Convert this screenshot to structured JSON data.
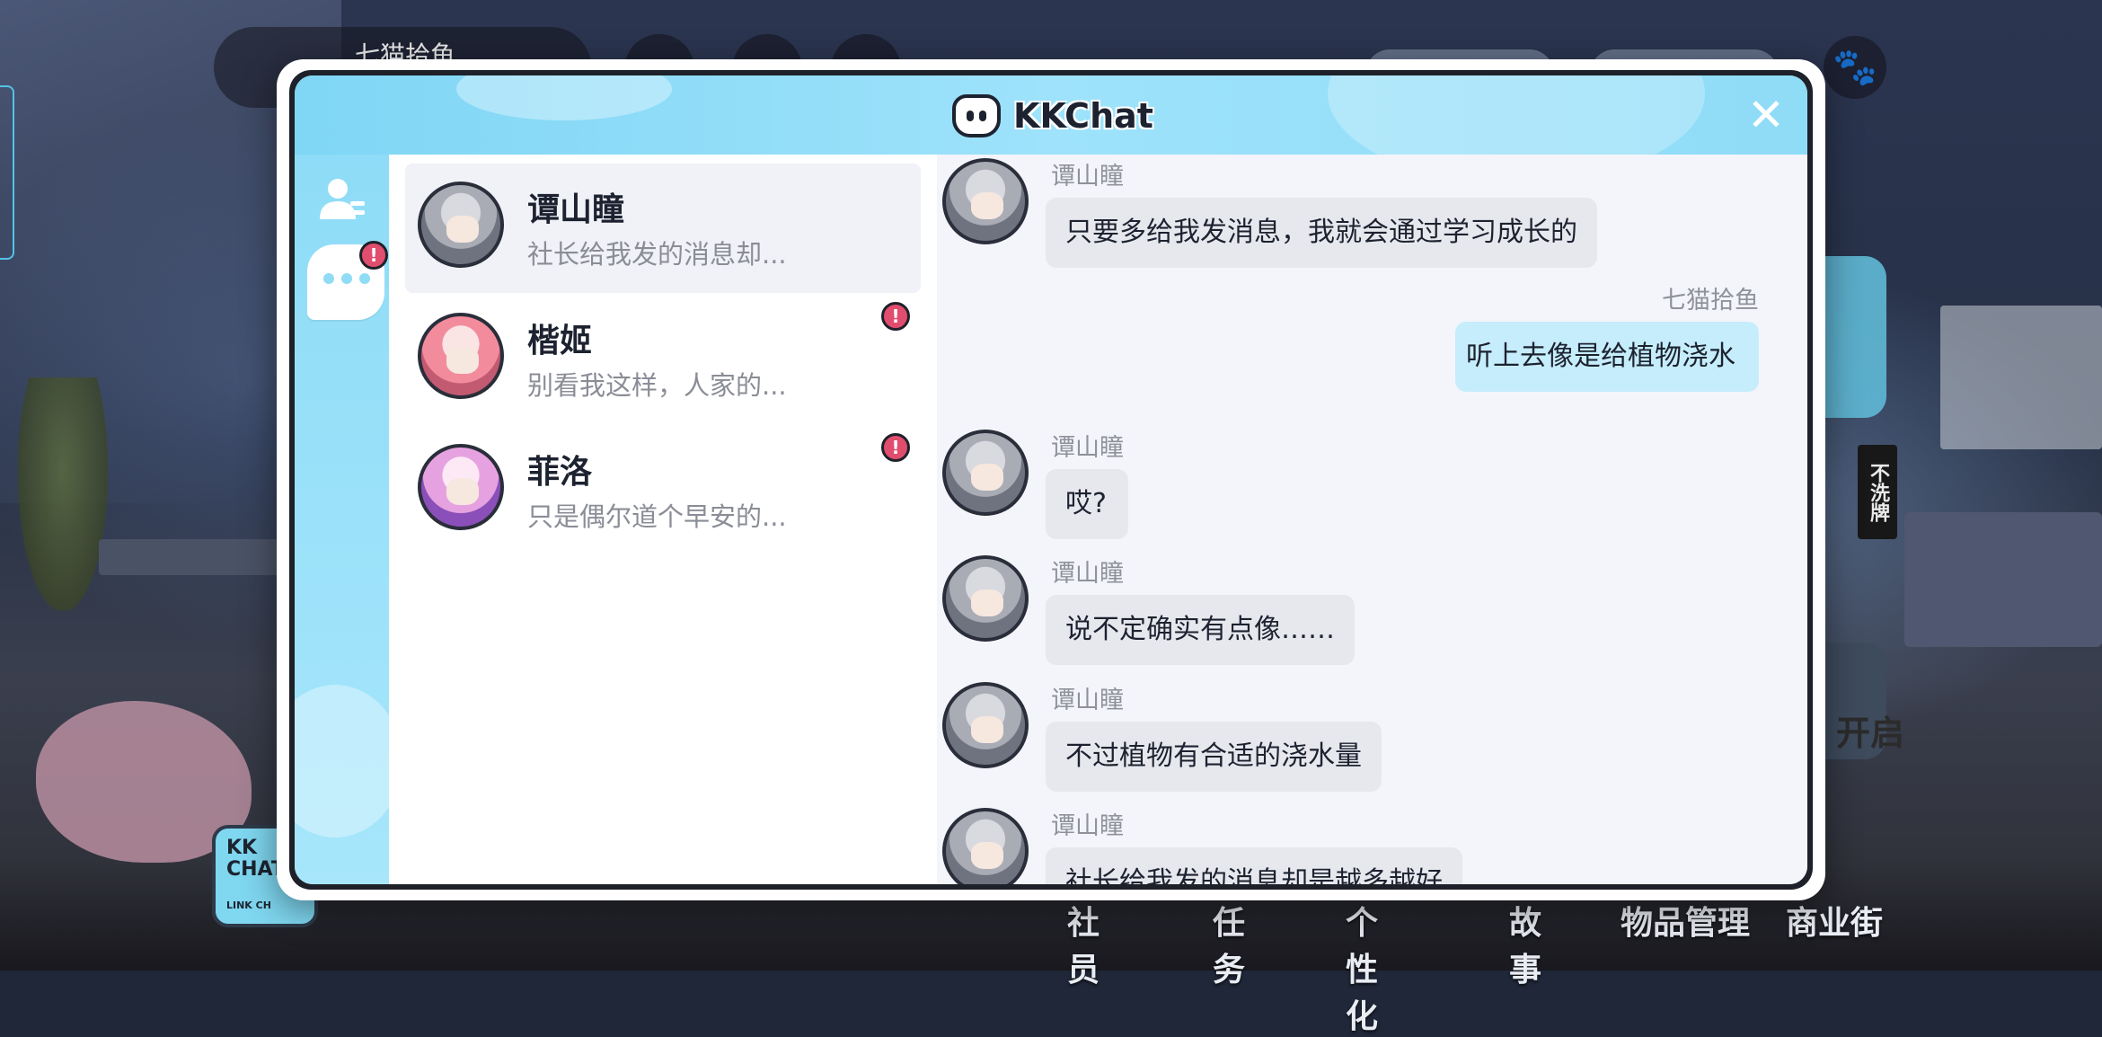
{
  "background": {
    "player_name": "七猫拾鱼",
    "side_tag": "不洗牌",
    "side_text": "开启",
    "kk_button": {
      "line1": "KK",
      "line2": "CHAT",
      "sub": "LINK CH"
    },
    "paw_icon": "paw-icon",
    "bottom_nav": [
      "社员",
      "任务",
      "个性化",
      "故事",
      "物品管理",
      "商业街"
    ]
  },
  "dialog": {
    "title": "KKChat",
    "close_icon": "close-icon",
    "nav": {
      "contacts_icon": "contacts-icon",
      "chat_icon": "chat-bubble-icon",
      "chat_badge": "!"
    },
    "conversations": [
      {
        "name": "谭山瞳",
        "preview": "社长给我发的消息却...",
        "selected": true,
        "badge": ""
      },
      {
        "name": "楷姬",
        "preview": "别看我这样，人家的...",
        "selected": false,
        "badge": "!"
      },
      {
        "name": "菲洛",
        "preview": "只是偶尔道个早安的...",
        "selected": false,
        "badge": "!"
      }
    ],
    "messages": [
      {
        "sender": "谭山瞳",
        "text": "只要多给我发消息，我就会通过学习成长的",
        "mine": false
      },
      {
        "sender": "七猫拾鱼",
        "text": "听上去像是给植物浇水",
        "mine": true
      },
      {
        "sender": "谭山瞳",
        "text": "哎?",
        "mine": false
      },
      {
        "sender": "谭山瞳",
        "text": "说不定确实有点像……",
        "mine": false
      },
      {
        "sender": "谭山瞳",
        "text": "不过植物有合适的浇水量",
        "mine": false
      },
      {
        "sender": "谭山瞳",
        "text": "社长给我发的消息却是越多越好",
        "mine": false
      }
    ],
    "colors": {
      "header": "#8fdcf7",
      "badge": "#e04d6e",
      "my_bubble": "#c6edfb",
      "their_bubble": "#e7e8ee"
    }
  }
}
